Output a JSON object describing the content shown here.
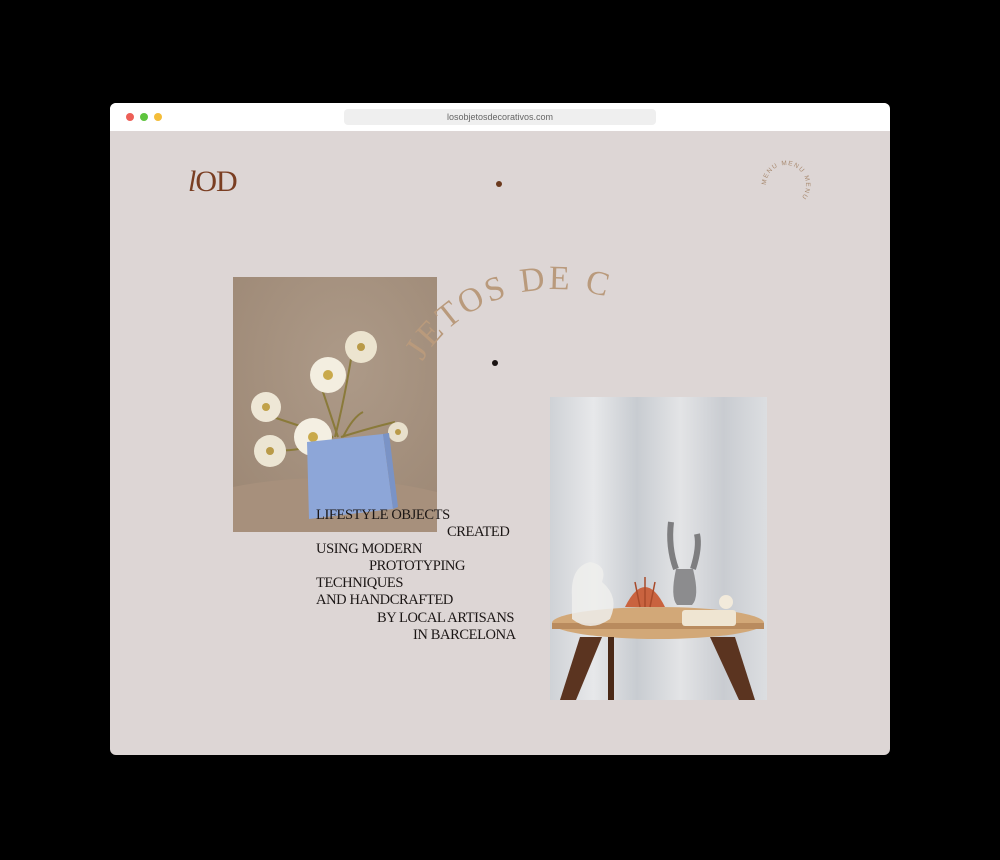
{
  "browser": {
    "url": "losobjetosdecorativos.com"
  },
  "header": {
    "logo_italic": "l",
    "logo_rest": "OD",
    "menu_label": "MENU",
    "menu_ring_text": "MENU MENU MENU "
  },
  "hero": {
    "arc_text": "JETOS DE C",
    "tagline_lines": [
      "LIFESTYLE OBJECTS",
      "CREATED",
      "USING MODERN",
      "PROTOTYPING",
      "TECHNIQUES",
      "AND HANDCRAFTED",
      "BY LOCAL ARTISANS",
      "IN BARCELONA"
    ]
  },
  "images": {
    "left": "photo-flowers-blue-vase",
    "right": "photo-table-objects"
  },
  "colors": {
    "page_background": "#ddd6d5",
    "logo": "#7a3e22",
    "arc_text": "#b99a7c",
    "tagline": "#1b1615"
  }
}
